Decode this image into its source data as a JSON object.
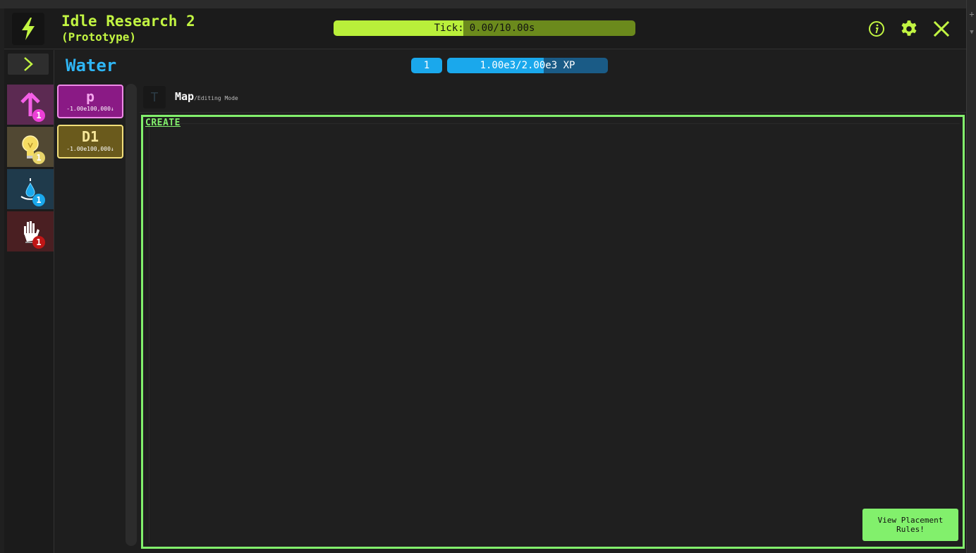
{
  "app": {
    "title": "Idle Research 2",
    "subtitle": "(Prototype)"
  },
  "tick": {
    "label": "Tick:",
    "value": "0.00/10.00s",
    "progress": 0.0
  },
  "header_icons": [
    "info-icon",
    "gear-icon",
    "close-icon"
  ],
  "sidebar": {
    "categories": [
      {
        "icon": "arrow-up-icon",
        "badge": "1",
        "bg": "#5c2a52",
        "badge_color": "#ec3fd6"
      },
      {
        "icon": "lightbulb-icon",
        "badge": "1",
        "bg": "#514833",
        "badge_color": "#e7d46a"
      },
      {
        "icon": "water-drop-icon",
        "badge": "1",
        "bg": "#1f3a4b",
        "badge_color": "#1aa8ec"
      },
      {
        "icon": "hand-icon",
        "badge": "1",
        "bg": "#4a1f22",
        "badge_color": "#c01616"
      }
    ]
  },
  "section": {
    "title": "Water",
    "level": "1",
    "xp": "1.00e3/2.00e3 XP",
    "xp_progress": 0.5
  },
  "resources": [
    {
      "name": "p",
      "amount": "-1.00e100,000",
      "bg": "#8a1a85",
      "border": "#f08ae8",
      "color": "#f5a6ee"
    },
    {
      "name": "D1",
      "amount": "-1.00e100,000",
      "bg": "#6a5a1c",
      "border": "#f2df7a",
      "color": "#f7e79a"
    }
  ],
  "tab": {
    "letter": "T",
    "title": "Map",
    "mode": "/Editing Mode"
  },
  "editor": {
    "create_label": "CREATE",
    "rules_button": "View Placement Rules!"
  },
  "colors": {
    "accent_green": "#c2f542",
    "water_blue": "#1aa8ec",
    "editor_border": "#82f06c"
  }
}
